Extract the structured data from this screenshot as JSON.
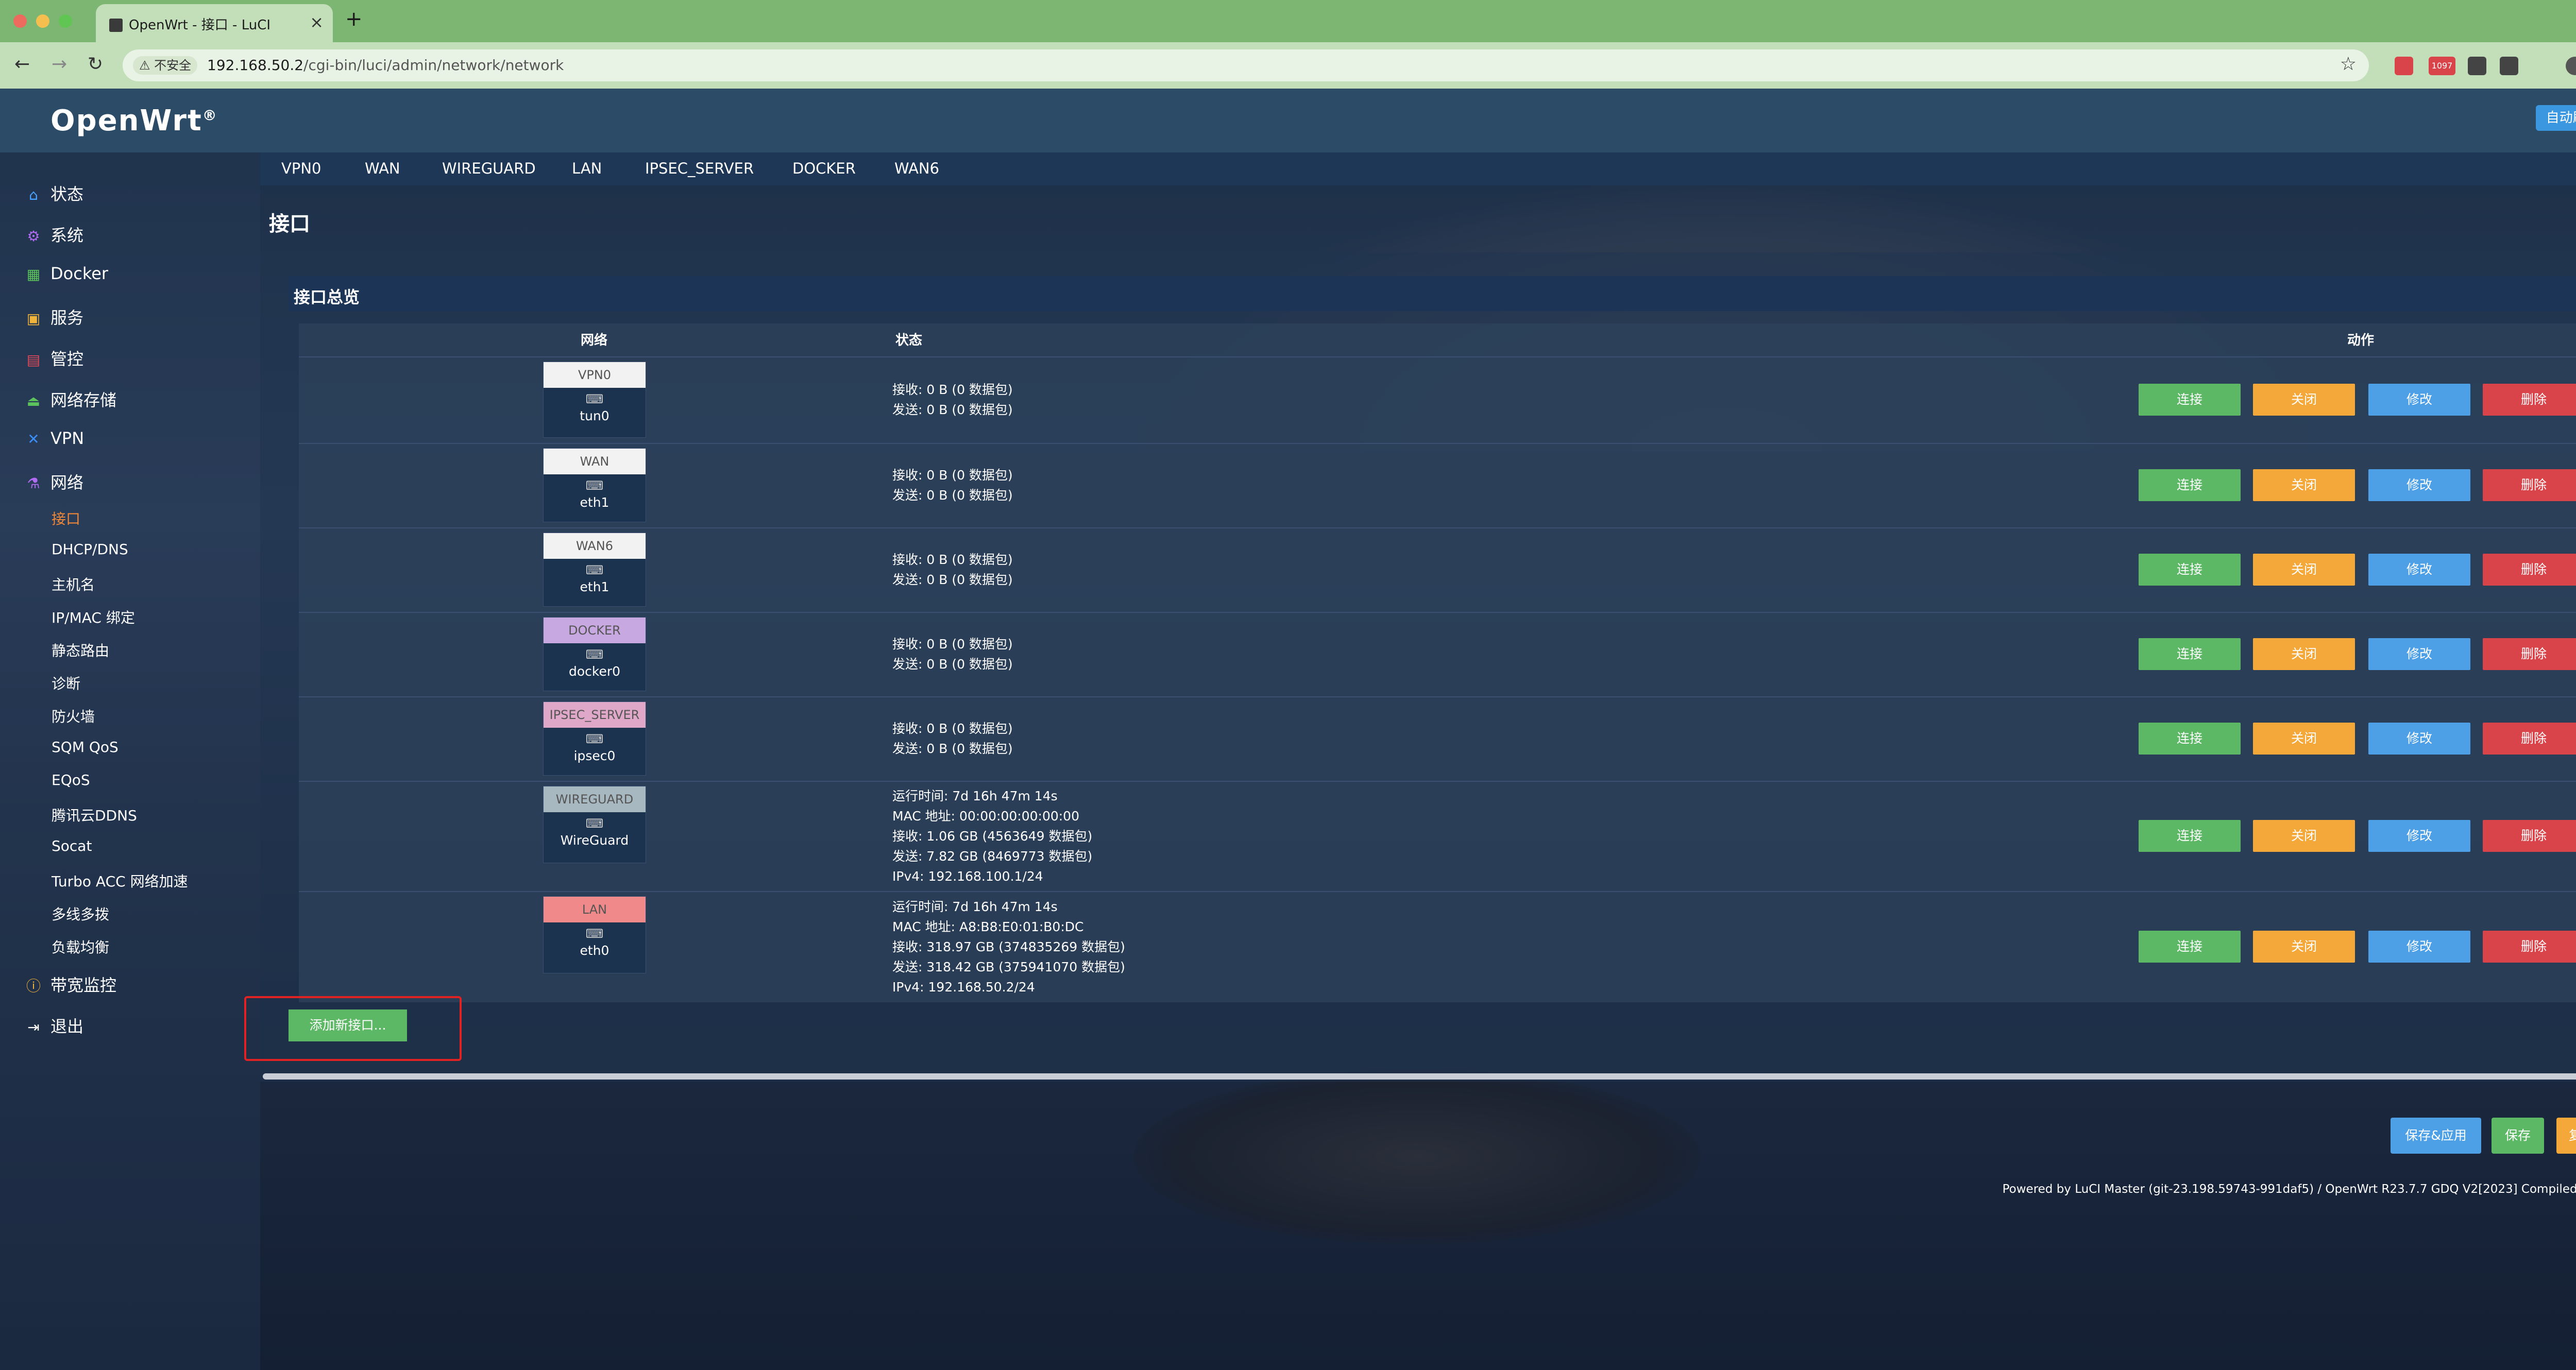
{
  "browser": {
    "tab_title": "OpenWrt - 接口 - LuCI",
    "tab_close": "×",
    "new_tab": "+",
    "security_label": "⚠ 不安全",
    "url_host": "192.168.50.2",
    "url_path": "/cgi-bin/luci/admin/network/network",
    "ext_badge": "1097",
    "nav_icons": [
      "back-icon",
      "forward-icon",
      "reload-icon"
    ]
  },
  "header": {
    "brand": "OpenWrt",
    "brand_mark": "®",
    "auto_refresh": "自动刷新 开"
  },
  "sidebar": {
    "items": [
      {
        "label": "状态",
        "icon": "home-icon",
        "glyph": "⌂",
        "color": "#4aa3ff"
      },
      {
        "label": "系统",
        "icon": "gear-icon",
        "glyph": "⚙",
        "color": "#b06cf0"
      },
      {
        "label": "Docker",
        "icon": "grid-icon",
        "glyph": "▦",
        "color": "#5cc35c"
      },
      {
        "label": "服务",
        "icon": "services-icon",
        "glyph": "▣",
        "color": "#f0b43a"
      },
      {
        "label": "管控",
        "icon": "control-icon",
        "glyph": "▤",
        "color": "#e04a58"
      },
      {
        "label": "网络存储",
        "icon": "storage-icon",
        "glyph": "⏏",
        "color": "#5cc35c"
      },
      {
        "label": "VPN",
        "icon": "vpn-icon",
        "glyph": "✕",
        "color": "#3a8ef5"
      },
      {
        "label": "网络",
        "icon": "network-icon",
        "glyph": "⚗",
        "color": "#b06cf0"
      }
    ],
    "sub_items": [
      "接口",
      "DHCP/DNS",
      "主机名",
      "IP/MAC 绑定",
      "静态路由",
      "诊断",
      "防火墙",
      "SQM QoS",
      "EQoS",
      "腾讯云DDNS",
      "Socat",
      "Turbo ACC 网络加速",
      "多线多拨",
      "负载均衡"
    ],
    "bottom_items": [
      {
        "label": "带宽监控",
        "icon": "bandwidth-icon",
        "glyph": "ⓘ",
        "color": "#f0b43a"
      },
      {
        "label": "退出",
        "icon": "logout-icon",
        "glyph": "⇥",
        "color": "#ffffff"
      }
    ]
  },
  "tabs": [
    "VPN0",
    "WAN",
    "WIREGUARD",
    "LAN",
    "IPSEC_SERVER",
    "DOCKER",
    "WAN6"
  ],
  "page_title": "接口",
  "section_title": "接口总览",
  "table": {
    "headers": {
      "network": "网络",
      "status": "状态",
      "actions": "动作"
    },
    "rows": [
      {
        "name": "VPN0",
        "dev": "tun0",
        "color": "#f2f2f2",
        "status": [
          "接收: 0 B (0 数据包)",
          "发送: 0 B (0 数据包)"
        ]
      },
      {
        "name": "WAN",
        "dev": "eth1",
        "color": "#f2f2f2",
        "status": [
          "接收: 0 B (0 数据包)",
          "发送: 0 B (0 数据包)"
        ]
      },
      {
        "name": "WAN6",
        "dev": "eth1",
        "color": "#f2f2f2",
        "status": [
          "接收: 0 B (0 数据包)",
          "发送: 0 B (0 数据包)"
        ]
      },
      {
        "name": "DOCKER",
        "dev": "docker0",
        "color": "#c8a8e0",
        "status": [
          "接收: 0 B (0 数据包)",
          "发送: 0 B (0 数据包)"
        ]
      },
      {
        "name": "IPSEC_SERVER",
        "dev": "ipsec0",
        "color": "#e0a8c8",
        "status": [
          "接收: 0 B (0 数据包)",
          "发送: 0 B (0 数据包)"
        ]
      },
      {
        "name": "WIREGUARD",
        "dev": "WireGuard",
        "color": "#a8b8c0",
        "status": [
          "运行时间: 7d 16h 47m 14s",
          "MAC 地址: 00:00:00:00:00:00",
          "接收: 1.06 GB (4563649 数据包)",
          "发送: 7.82 GB (8469773 数据包)",
          "IPv4: 192.168.100.1/24"
        ]
      },
      {
        "name": "LAN",
        "dev": "eth0",
        "color": "#f08a8a",
        "status": [
          "运行时间: 7d 16h 47m 14s",
          "MAC 地址: A8:B8:E0:01:B0:DC",
          "接收: 318.97 GB (374835269 数据包)",
          "发送: 318.42 GB (375941070 数据包)",
          "IPv4: 192.168.50.2/24"
        ]
      }
    ],
    "buttons": {
      "connect": "连接",
      "close": "关闭",
      "edit": "修改",
      "delete": "删除"
    }
  },
  "add_interface": "添加新接口...",
  "actions": {
    "save_apply": "保存&应用",
    "save": "保存",
    "reset": "复位"
  },
  "footer": "Powered by LuCI Master (git-23.198.59743-991daf5) / OpenWrt R23.7.7 GDQ V2[2023] Compiled by eSir"
}
